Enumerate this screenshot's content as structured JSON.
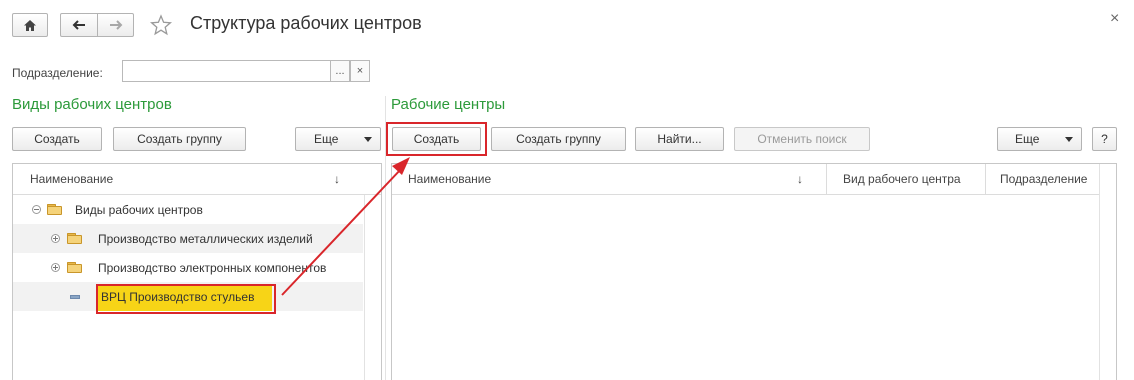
{
  "window": {
    "title": "Структура рабочих центров",
    "close_glyph": "×"
  },
  "nav": {
    "home_icon": "home-icon",
    "back_icon": "arrow-left-icon",
    "forward_icon": "arrow-right-icon",
    "favorite_icon": "star-icon"
  },
  "filter": {
    "label": "Подразделение:",
    "value": "",
    "select_glyph": "...",
    "clear_glyph": "×"
  },
  "left": {
    "title": "Виды рабочих центров",
    "create_label": "Создать",
    "create_group_label": "Создать группу",
    "more_label": "Еще",
    "column_name": "Наименование",
    "sort_glyph": "↓",
    "tree": [
      {
        "label": "Виды рабочих центров",
        "type": "root-folder",
        "expanded": true
      },
      {
        "label": "Производство металлических изделий",
        "type": "folder",
        "expanded": false
      },
      {
        "label": "Производство электронных компонентов",
        "type": "folder",
        "expanded": false
      },
      {
        "label": "ВРЦ Производство стульев",
        "type": "item",
        "selected": true
      }
    ]
  },
  "right": {
    "title": "Рабочие центры",
    "create_label": "Создать",
    "create_group_label": "Создать группу",
    "find_label": "Найти...",
    "cancel_search_label": "Отменить поиск",
    "more_label": "Еще",
    "help_label": "?",
    "columns": [
      "Наименование",
      "Вид рабочего центра",
      "Подразделение"
    ],
    "sort_glyph": "↓"
  },
  "colors": {
    "section_title": "#2c9a3a",
    "highlight": "#f7d417",
    "annotation": "#d9262b"
  }
}
